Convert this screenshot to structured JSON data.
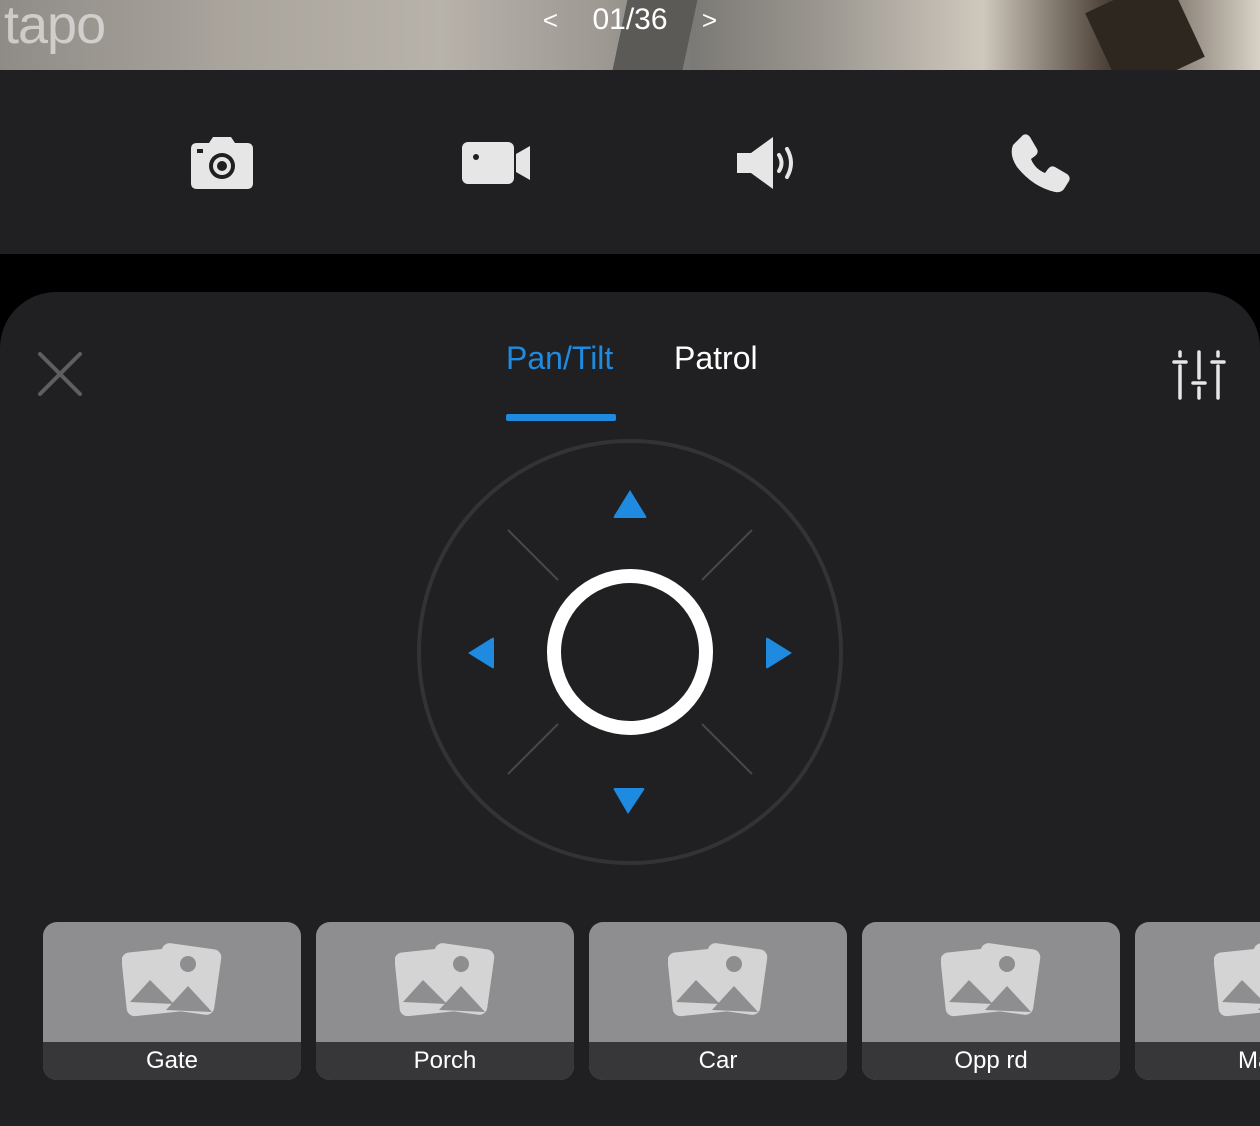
{
  "feed": {
    "logo": "tapo",
    "counter": "01/36",
    "prev": "<",
    "next": ">"
  },
  "toolbar": {
    "buttons": [
      {
        "icon": "camera-icon",
        "action": "snapshot"
      },
      {
        "icon": "video-camera-icon",
        "action": "record"
      },
      {
        "icon": "speaker-icon",
        "action": "audio"
      },
      {
        "icon": "phone-icon",
        "action": "talk"
      }
    ]
  },
  "sheet": {
    "tabs": [
      {
        "label": "Pan/Tilt",
        "active": true
      },
      {
        "label": "Patrol",
        "active": false
      }
    ],
    "close_icon": "close-icon",
    "settings_icon": "sliders-icon"
  },
  "presets": [
    {
      "label": "Gate"
    },
    {
      "label": "Porch"
    },
    {
      "label": "Car"
    },
    {
      "label": "Opp rd"
    },
    {
      "label": "Main"
    }
  ],
  "colors": {
    "accent": "#1e8be0",
    "panel": "#202022",
    "background": "#000000",
    "preset_thumb": "#8e8e90",
    "preset_label": "#37373a"
  }
}
